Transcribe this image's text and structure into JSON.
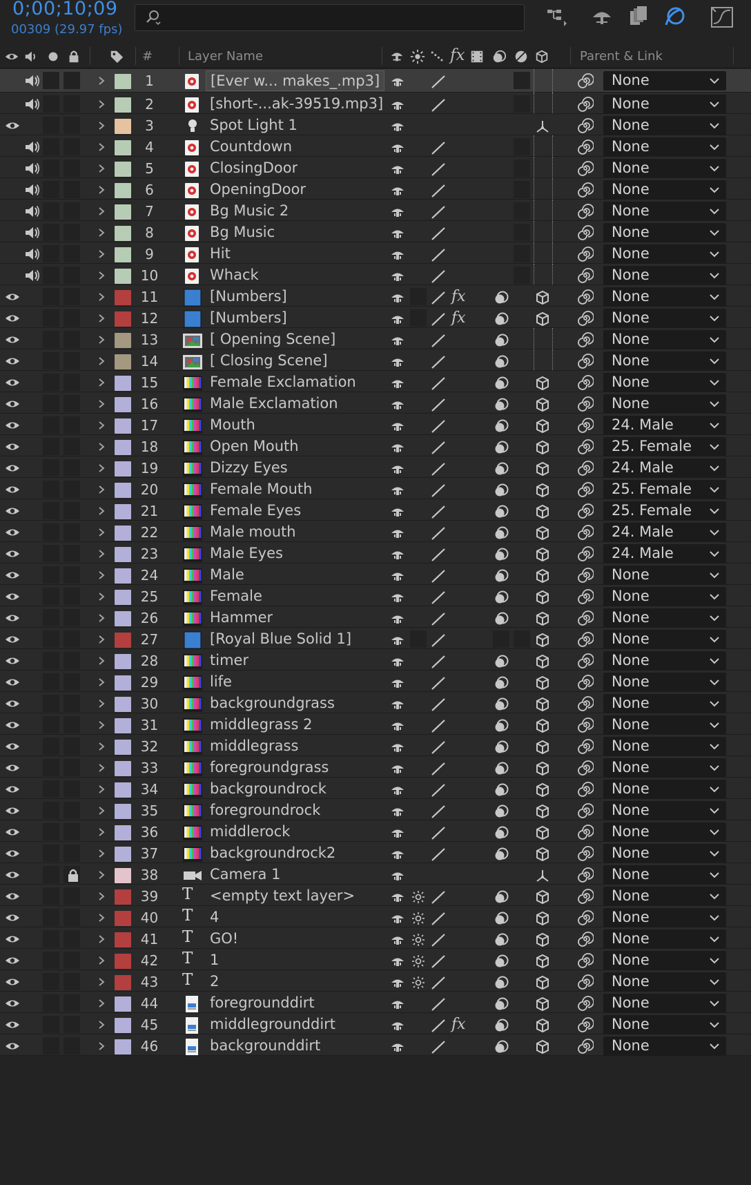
{
  "timecode": "0;00;10;09",
  "frame_info": "00309 (29.97 fps)",
  "header": {
    "layer_name_label": "Layer Name",
    "num_label": "#",
    "parent_label": "Parent & Link"
  },
  "colors": {
    "accent_blue": "#3f8fe8",
    "label_green": "#b7ccb4",
    "label_peach": "#e6c2a0",
    "label_red": "#b3403f",
    "label_tan": "#a59880",
    "label_lavender": "#b2b0d8",
    "label_pink": "#e4c4cc"
  },
  "layers": [
    {
      "num": "1",
      "name": "[Ever w... makes_.mp3]",
      "label": "label_green",
      "eye": false,
      "audio": true,
      "type": "audio",
      "selected": true,
      "fx": false,
      "motion": false,
      "d3": "none",
      "parent": "None"
    },
    {
      "num": "2",
      "name": "[short-...ak-39519.mp3]",
      "label": "label_green",
      "eye": false,
      "audio": true,
      "type": "audio",
      "fx": false,
      "motion": false,
      "d3": "none",
      "parent": "None"
    },
    {
      "num": "3",
      "name": "Spot Light 1",
      "label": "label_peach",
      "eye": true,
      "audio": false,
      "type": "light",
      "fx": false,
      "motion": false,
      "d3": "light",
      "noquality": true,
      "parent": "None"
    },
    {
      "num": "4",
      "name": "Countdown",
      "label": "label_green",
      "eye": false,
      "audio": true,
      "type": "audio",
      "fx": false,
      "motion": false,
      "d3": "none",
      "parent": "None"
    },
    {
      "num": "5",
      "name": "ClosingDoor",
      "label": "label_green",
      "eye": false,
      "audio": true,
      "type": "audio",
      "fx": false,
      "motion": false,
      "d3": "none",
      "parent": "None"
    },
    {
      "num": "6",
      "name": "OpeningDoor",
      "label": "label_green",
      "eye": false,
      "audio": true,
      "type": "audio",
      "fx": false,
      "motion": false,
      "d3": "none",
      "parent": "None"
    },
    {
      "num": "7",
      "name": "Bg Music 2",
      "label": "label_green",
      "eye": false,
      "audio": true,
      "type": "audio",
      "fx": false,
      "motion": false,
      "d3": "none",
      "parent": "None"
    },
    {
      "num": "8",
      "name": "Bg Music",
      "label": "label_green",
      "eye": false,
      "audio": true,
      "type": "audio",
      "fx": false,
      "motion": false,
      "d3": "none",
      "parent": "None"
    },
    {
      "num": "9",
      "name": "Hit",
      "label": "label_green",
      "eye": false,
      "audio": true,
      "type": "audio",
      "fx": false,
      "motion": false,
      "d3": "none",
      "parent": "None"
    },
    {
      "num": "10",
      "name": "Whack",
      "label": "label_green",
      "eye": false,
      "audio": true,
      "type": "audio",
      "fx": false,
      "motion": false,
      "d3": "none",
      "parent": "None"
    },
    {
      "num": "11",
      "name": "[Numbers]",
      "label": "label_red",
      "eye": true,
      "audio": false,
      "type": "solid",
      "fx": true,
      "motion": true,
      "d3": "cube",
      "parent": "None"
    },
    {
      "num": "12",
      "name": "[Numbers]",
      "label": "label_red",
      "eye": true,
      "audio": false,
      "type": "solid",
      "fx": true,
      "motion": true,
      "d3": "cube",
      "parent": "None"
    },
    {
      "num": "13",
      "name": "[ Opening Scene]",
      "label": "label_tan",
      "eye": true,
      "audio": false,
      "type": "comp",
      "fx": false,
      "motion": true,
      "d3": "empty",
      "parent": "None"
    },
    {
      "num": "14",
      "name": "[ Closing Scene]",
      "label": "label_tan",
      "eye": true,
      "audio": false,
      "type": "comp",
      "fx": false,
      "motion": true,
      "d3": "empty",
      "parent": "None"
    },
    {
      "num": "15",
      "name": "Female Exclamation",
      "label": "label_lavender",
      "eye": true,
      "audio": false,
      "type": "footage",
      "fx": false,
      "motion": true,
      "d3": "cube",
      "parent": "None"
    },
    {
      "num": "16",
      "name": "Male Exclamation",
      "label": "label_lavender",
      "eye": true,
      "audio": false,
      "type": "footage",
      "fx": false,
      "motion": true,
      "d3": "cube",
      "parent": "None"
    },
    {
      "num": "17",
      "name": "Mouth",
      "label": "label_lavender",
      "eye": true,
      "audio": false,
      "type": "footage",
      "fx": false,
      "motion": true,
      "d3": "cube",
      "parent": "24. Male"
    },
    {
      "num": "18",
      "name": "Open Mouth",
      "label": "label_lavender",
      "eye": true,
      "audio": false,
      "type": "footage",
      "fx": false,
      "motion": true,
      "d3": "cube",
      "parent": "25. Female"
    },
    {
      "num": "19",
      "name": "Dizzy Eyes",
      "label": "label_lavender",
      "eye": true,
      "audio": false,
      "type": "footage",
      "fx": false,
      "motion": true,
      "d3": "cube",
      "parent": "24. Male"
    },
    {
      "num": "20",
      "name": "Female Mouth",
      "label": "label_lavender",
      "eye": true,
      "audio": false,
      "type": "footage",
      "fx": false,
      "motion": true,
      "d3": "cube",
      "parent": "25. Female"
    },
    {
      "num": "21",
      "name": "Female Eyes",
      "label": "label_lavender",
      "eye": true,
      "audio": false,
      "type": "footage",
      "fx": false,
      "motion": true,
      "d3": "cube",
      "parent": "25. Female"
    },
    {
      "num": "22",
      "name": "Male mouth",
      "label": "label_lavender",
      "eye": true,
      "audio": false,
      "type": "footage",
      "fx": false,
      "motion": true,
      "d3": "cube",
      "parent": "24. Male"
    },
    {
      "num": "23",
      "name": "Male Eyes",
      "label": "label_lavender",
      "eye": true,
      "audio": false,
      "type": "footage",
      "fx": false,
      "motion": true,
      "d3": "cube",
      "parent": "24. Male"
    },
    {
      "num": "24",
      "name": "Male",
      "label": "label_lavender",
      "eye": true,
      "audio": false,
      "type": "footage",
      "fx": false,
      "motion": true,
      "d3": "cube",
      "parent": "None"
    },
    {
      "num": "25",
      "name": "Female",
      "label": "label_lavender",
      "eye": true,
      "audio": false,
      "type": "footage",
      "fx": false,
      "motion": true,
      "d3": "cube",
      "parent": "None"
    },
    {
      "num": "26",
      "name": "Hammer",
      "label": "label_lavender",
      "eye": true,
      "audio": false,
      "type": "footage",
      "fx": false,
      "motion": true,
      "d3": "cube",
      "parent": "None"
    },
    {
      "num": "27",
      "name": "[Royal Blue Solid 1]",
      "label": "label_red",
      "eye": true,
      "audio": false,
      "type": "solid",
      "fx": false,
      "motion": false,
      "d3": "cube",
      "parent": "None"
    },
    {
      "num": "28",
      "name": "timer",
      "label": "label_lavender",
      "eye": true,
      "audio": false,
      "type": "footage",
      "fx": false,
      "motion": true,
      "d3": "cube",
      "parent": "None"
    },
    {
      "num": "29",
      "name": "life",
      "label": "label_lavender",
      "eye": true,
      "audio": false,
      "type": "footage",
      "fx": false,
      "motion": true,
      "d3": "cube",
      "parent": "None"
    },
    {
      "num": "30",
      "name": "backgroundgrass",
      "label": "label_lavender",
      "eye": true,
      "audio": false,
      "type": "footage",
      "fx": false,
      "motion": true,
      "d3": "cube",
      "parent": "None"
    },
    {
      "num": "31",
      "name": "middlegrass 2",
      "label": "label_lavender",
      "eye": true,
      "audio": false,
      "type": "footage",
      "fx": false,
      "motion": true,
      "d3": "cube",
      "parent": "None"
    },
    {
      "num": "32",
      "name": "middlegrass",
      "label": "label_lavender",
      "eye": true,
      "audio": false,
      "type": "footage",
      "fx": false,
      "motion": true,
      "d3": "cube",
      "parent": "None"
    },
    {
      "num": "33",
      "name": "foregroundgrass",
      "label": "label_lavender",
      "eye": true,
      "audio": false,
      "type": "footage",
      "fx": false,
      "motion": true,
      "d3": "cube",
      "parent": "None"
    },
    {
      "num": "34",
      "name": "backgroundrock",
      "label": "label_lavender",
      "eye": true,
      "audio": false,
      "type": "footage",
      "fx": false,
      "motion": true,
      "d3": "cube",
      "parent": "None"
    },
    {
      "num": "35",
      "name": "foregroundrock",
      "label": "label_lavender",
      "eye": true,
      "audio": false,
      "type": "footage",
      "fx": false,
      "motion": true,
      "d3": "cube",
      "parent": "None"
    },
    {
      "num": "36",
      "name": "middlerock",
      "label": "label_lavender",
      "eye": true,
      "audio": false,
      "type": "footage",
      "fx": false,
      "motion": true,
      "d3": "cube",
      "parent": "None"
    },
    {
      "num": "37",
      "name": "backgroundrock2",
      "label": "label_lavender",
      "eye": true,
      "audio": false,
      "type": "footage",
      "fx": false,
      "motion": true,
      "d3": "cube",
      "parent": "None"
    },
    {
      "num": "38",
      "name": "Camera 1",
      "label": "label_pink",
      "eye": true,
      "audio": false,
      "locked": true,
      "type": "camera",
      "fx": false,
      "motion": false,
      "d3": "light",
      "noquality": true,
      "parent": "None"
    },
    {
      "num": "39",
      "name": "<empty text layer>",
      "label": "label_red",
      "eye": true,
      "audio": false,
      "type": "text",
      "fx": false,
      "motion": true,
      "d3": "cube",
      "parent": "None"
    },
    {
      "num": "40",
      "name": "4",
      "label": "label_red",
      "eye": true,
      "audio": false,
      "type": "text",
      "fx": false,
      "motion": true,
      "d3": "cube",
      "parent": "None"
    },
    {
      "num": "41",
      "name": "GO!",
      "label": "label_red",
      "eye": true,
      "audio": false,
      "type": "text",
      "fx": false,
      "motion": true,
      "d3": "cube",
      "parent": "None"
    },
    {
      "num": "42",
      "name": "1",
      "label": "label_red",
      "eye": true,
      "audio": false,
      "type": "text",
      "fx": false,
      "motion": true,
      "d3": "cube",
      "parent": "None"
    },
    {
      "num": "43",
      "name": "2",
      "label": "label_red",
      "eye": true,
      "audio": false,
      "type": "text",
      "fx": false,
      "motion": true,
      "d3": "cube",
      "parent": "None"
    },
    {
      "num": "44",
      "name": "foregrounddirt",
      "label": "label_lavender",
      "eye": true,
      "audio": false,
      "type": "file",
      "fx": false,
      "motion": true,
      "d3": "cube",
      "parent": "None"
    },
    {
      "num": "45",
      "name": "middlegrounddirt",
      "label": "label_lavender",
      "eye": true,
      "audio": false,
      "type": "file",
      "fx": true,
      "motion": true,
      "d3": "cube",
      "parent": "None"
    },
    {
      "num": "46",
      "name": "backgrounddirt",
      "label": "label_lavender",
      "eye": true,
      "audio": false,
      "type": "file",
      "fx": false,
      "motion": true,
      "d3": "cube",
      "parent": "None"
    }
  ]
}
